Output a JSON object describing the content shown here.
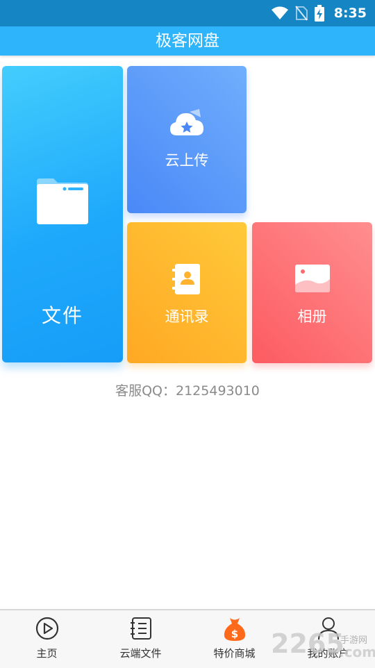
{
  "status_bar": {
    "time": "8:35",
    "icons": [
      "wifi-icon",
      "no-sim-icon",
      "battery-charging-icon"
    ]
  },
  "app": {
    "title": "极客网盘"
  },
  "tiles": {
    "files": {
      "label": "文件",
      "icon": "folder-icon"
    },
    "upload": {
      "label": "云上传",
      "icon": "cloud-star-icon"
    },
    "contacts": {
      "label": "通讯录",
      "icon": "contact-book-icon"
    },
    "album": {
      "label": "相册",
      "icon": "photo-icon"
    }
  },
  "service": {
    "qq_text": "客服QQ：2125493010"
  },
  "bottom_nav": [
    {
      "label": "主页",
      "icon": "play-circle-icon"
    },
    {
      "label": "云端文件",
      "icon": "document-list-icon"
    },
    {
      "label": "特价商城",
      "icon": "money-bag-icon"
    },
    {
      "label": "我的账户",
      "icon": "user-icon"
    }
  ],
  "watermark": {
    "number": "2265",
    "text": "手游网",
    "domain": ".com"
  },
  "colors": {
    "status_bar": "#1585c4",
    "title_bar": "#2eb4fb",
    "files_tile": "#1fa9fb",
    "upload_tile": "#4a88f7",
    "contacts_tile": "#ffb22e",
    "album_tile": "#fc6a6f",
    "mall_icon": "#ff6a1a"
  }
}
